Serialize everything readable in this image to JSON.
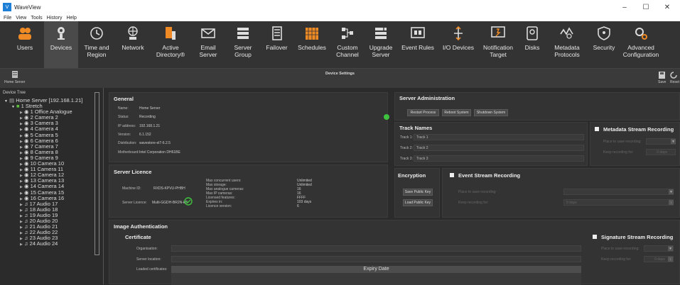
{
  "window": {
    "title": "WaveView",
    "app_icon": "V"
  },
  "menu": [
    "File",
    "View",
    "Tools",
    "History",
    "Help"
  ],
  "ribbon": [
    {
      "label": "Users",
      "icon": "users-icon",
      "active": false,
      "color": "#f08a24"
    },
    {
      "label": "Devices",
      "icon": "camera-icon",
      "active": true,
      "color": "#dddddd"
    },
    {
      "label": "Time and\nRegion",
      "icon": "globe-clock-icon",
      "active": false,
      "color": "#dddddd"
    },
    {
      "label": "Network",
      "icon": "network-icon",
      "active": false,
      "color": "#dddddd"
    },
    {
      "label": "Active\nDirectory®",
      "icon": "directory-icon",
      "active": false,
      "color": "#f08a24"
    },
    {
      "label": "Email\nServer",
      "icon": "email-icon",
      "active": false,
      "color": "#dddddd"
    },
    {
      "label": "Server\nGroup",
      "icon": "server-group-icon",
      "active": false,
      "color": "#dddddd"
    },
    {
      "label": "Failover",
      "icon": "failover-icon",
      "active": false,
      "color": "#dddddd"
    },
    {
      "label": "Schedules",
      "icon": "schedule-icon",
      "active": false,
      "color": "#f08a24"
    },
    {
      "label": "Custom\nChannel",
      "icon": "custom-channel-icon",
      "active": false,
      "color": "#dddddd"
    },
    {
      "label": "Upgrade\nServer",
      "icon": "upgrade-icon",
      "active": false,
      "color": "#dddddd"
    },
    {
      "label": "Event Rules",
      "icon": "event-rules-icon",
      "active": false,
      "color": "#dddddd"
    },
    {
      "label": "I/O Devices",
      "icon": "io-devices-icon",
      "active": false,
      "color": "#f08a24"
    },
    {
      "label": "Notification\nTarget",
      "icon": "notification-icon",
      "active": false,
      "color": "#dddddd"
    },
    {
      "label": "Disks",
      "icon": "disk-icon",
      "active": false,
      "color": "#dddddd"
    },
    {
      "label": "Metadata\nProtocols",
      "icon": "metadata-icon",
      "active": false,
      "color": "#dddddd"
    },
    {
      "label": "Security",
      "icon": "shield-icon",
      "active": false,
      "color": "#dddddd"
    },
    {
      "label": "Advanced\nConfiguration",
      "icon": "advanced-config-icon",
      "active": false,
      "color": "#f08a24"
    }
  ],
  "subbar": {
    "home_server_label": "Home Server",
    "title": "Device Settings",
    "save": "Save",
    "reset": "Reset"
  },
  "tree": {
    "title": "Device Tree",
    "server": "Home Server [192.168.1.21]",
    "stretch": "1 Stretch",
    "items": [
      "1 Office Analogue",
      "2 Camera 2",
      "3 Camera 3",
      "4 Camera 4",
      "5 Camera 5",
      "6 Camera 6",
      "7 Camera 7",
      "8 Camera 8",
      "9 Camera 9",
      "10 Camera 10",
      "11 Camera 11",
      "12 Camera 12",
      "13 Camera 13",
      "14 Camera 14",
      "15 Camera 15",
      "16 Camera 16",
      "17 Audio 17",
      "18 Audio 18",
      "19 Audio 19",
      "20 Audio 20",
      "21 Audio 21",
      "22 Audio 22",
      "23 Audio 23",
      "24 Audio 24"
    ]
  },
  "general": {
    "heading": "General",
    "rows": [
      {
        "label": "Name:",
        "value": "Home Server"
      },
      {
        "label": "Status:",
        "value": "Recording"
      },
      {
        "label": "IP address:",
        "value": "192.168.1.21"
      },
      {
        "label": "Version:",
        "value": "6.1.152"
      },
      {
        "label": "Distribution:",
        "value": "wavestore-el7-6.2.5"
      },
      {
        "label": "Motherboard:",
        "value": "Intel Corporation DH61BE"
      }
    ],
    "status_color": "#3ec23e"
  },
  "licence": {
    "heading": "Server Licence",
    "machine_id_label": "Machine ID:",
    "machine_id": "RXDS-KPVU-PHBH",
    "server_licence_label": "Server Licence:",
    "server_licence": "Multi-GGDH-BR2N-kG",
    "specs": [
      {
        "label": "Max concurrent users:",
        "value": "Unlimited"
      },
      {
        "label": "Max storage:",
        "value": "Unlimited"
      },
      {
        "label": "Max analogue cameras:",
        "value": "16"
      },
      {
        "label": "Max IP cameras:",
        "value": "16"
      },
      {
        "label": "Licensed features:",
        "value": "FFFF"
      },
      {
        "label": "Expires in:",
        "value": "103 days"
      },
      {
        "label": "Licence version:",
        "value": "6"
      }
    ]
  },
  "server_admin": {
    "heading": "Server Administration",
    "buttons": [
      "Restart Process",
      "Reboot System",
      "Shutdown System"
    ]
  },
  "track_names": {
    "heading": "Track Names",
    "tracks": [
      {
        "label": "Track 1:",
        "value": "Track 1"
      },
      {
        "label": "Track 2:",
        "value": "Track 2"
      },
      {
        "label": "Track 3:",
        "value": "Track 3"
      }
    ]
  },
  "metadata_stream": {
    "heading": "Metadata Stream Recording",
    "place_label": "Place to save recording:",
    "keep_label": "Keep recording for:",
    "keep_value": "0 days"
  },
  "encryption": {
    "heading": "Encryption",
    "save_key": "Save Public Key",
    "load_key": "Load Public Key"
  },
  "event_stream": {
    "heading": "Event Stream Recording",
    "place_label": "Place to save recording:",
    "keep_label": "Keep recording for:",
    "keep_value": "0 days"
  },
  "image_auth": {
    "heading": "Image Authentication",
    "cert_heading": "Certificate",
    "organisation_label": "Organisation:",
    "server_location_label": "Server location:",
    "loaded_certs_label": "Loaded certificates:",
    "expiry_header": "Expiry Date"
  },
  "signature_stream": {
    "heading": "Signature Stream Recording",
    "place_label": "Place to save recording:",
    "keep_label": "Keep recording for:",
    "keep_value": "0 days"
  }
}
